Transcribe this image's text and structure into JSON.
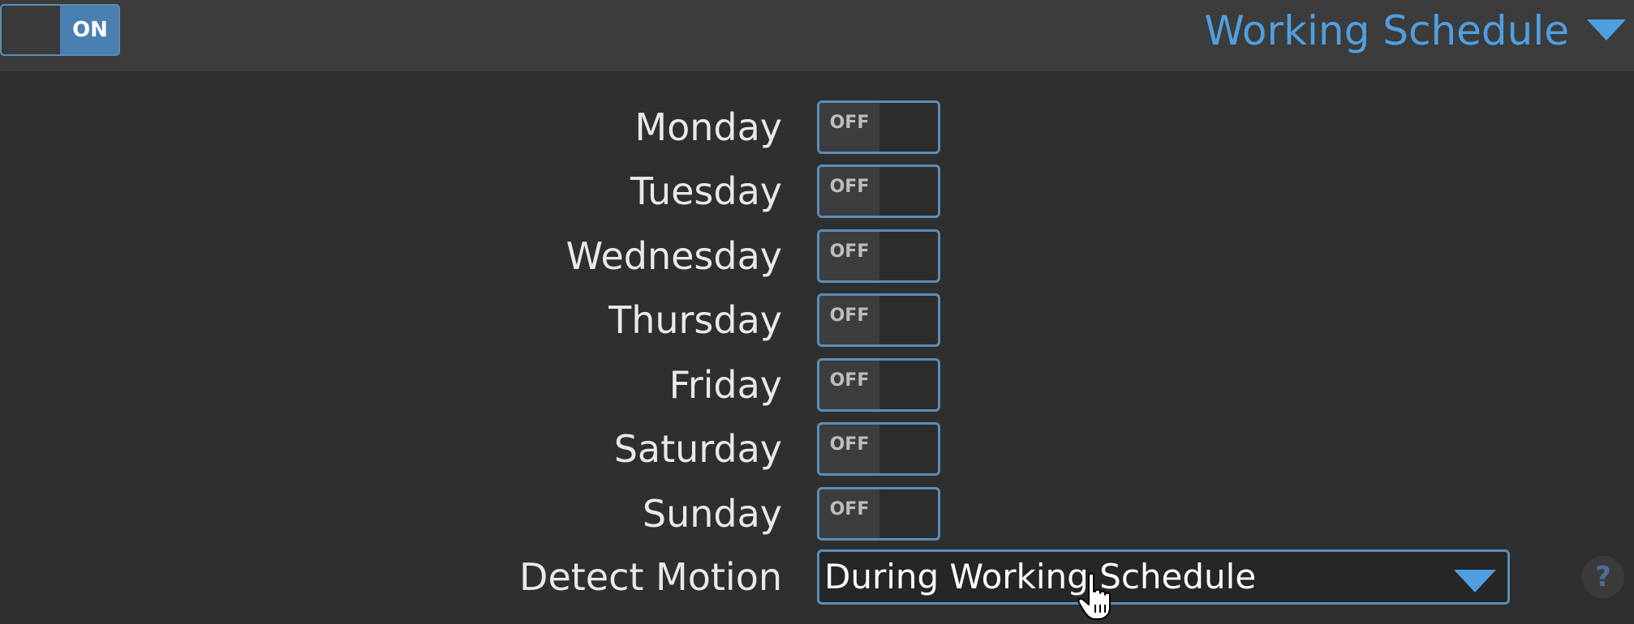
{
  "header": {
    "master_toggle": {
      "state_label": "ON",
      "on": true
    },
    "section_title": "Working Schedule",
    "section_caret_icon": "chevron-down-icon"
  },
  "days": [
    {
      "label": "Monday",
      "toggle_label": "OFF",
      "on": false
    },
    {
      "label": "Tuesday",
      "toggle_label": "OFF",
      "on": false
    },
    {
      "label": "Wednesday",
      "toggle_label": "OFF",
      "on": false
    },
    {
      "label": "Thursday",
      "toggle_label": "OFF",
      "on": false
    },
    {
      "label": "Friday",
      "toggle_label": "OFF",
      "on": false
    },
    {
      "label": "Saturday",
      "toggle_label": "OFF",
      "on": false
    },
    {
      "label": "Sunday",
      "toggle_label": "OFF",
      "on": false
    }
  ],
  "detect_motion": {
    "label": "Detect Motion",
    "selected_value": "During Working Schedule",
    "caret_icon": "chevron-down-icon"
  },
  "help": {
    "label": "?",
    "icon": "help-icon"
  },
  "cursor_icon": "hand-pointer-icon",
  "colors": {
    "accent": "#4f9fe0",
    "toggle_border": "#5a8db8",
    "on_fill": "#4a7fb1",
    "background": "#2f2f2f",
    "header_background": "#3c3c3c"
  }
}
